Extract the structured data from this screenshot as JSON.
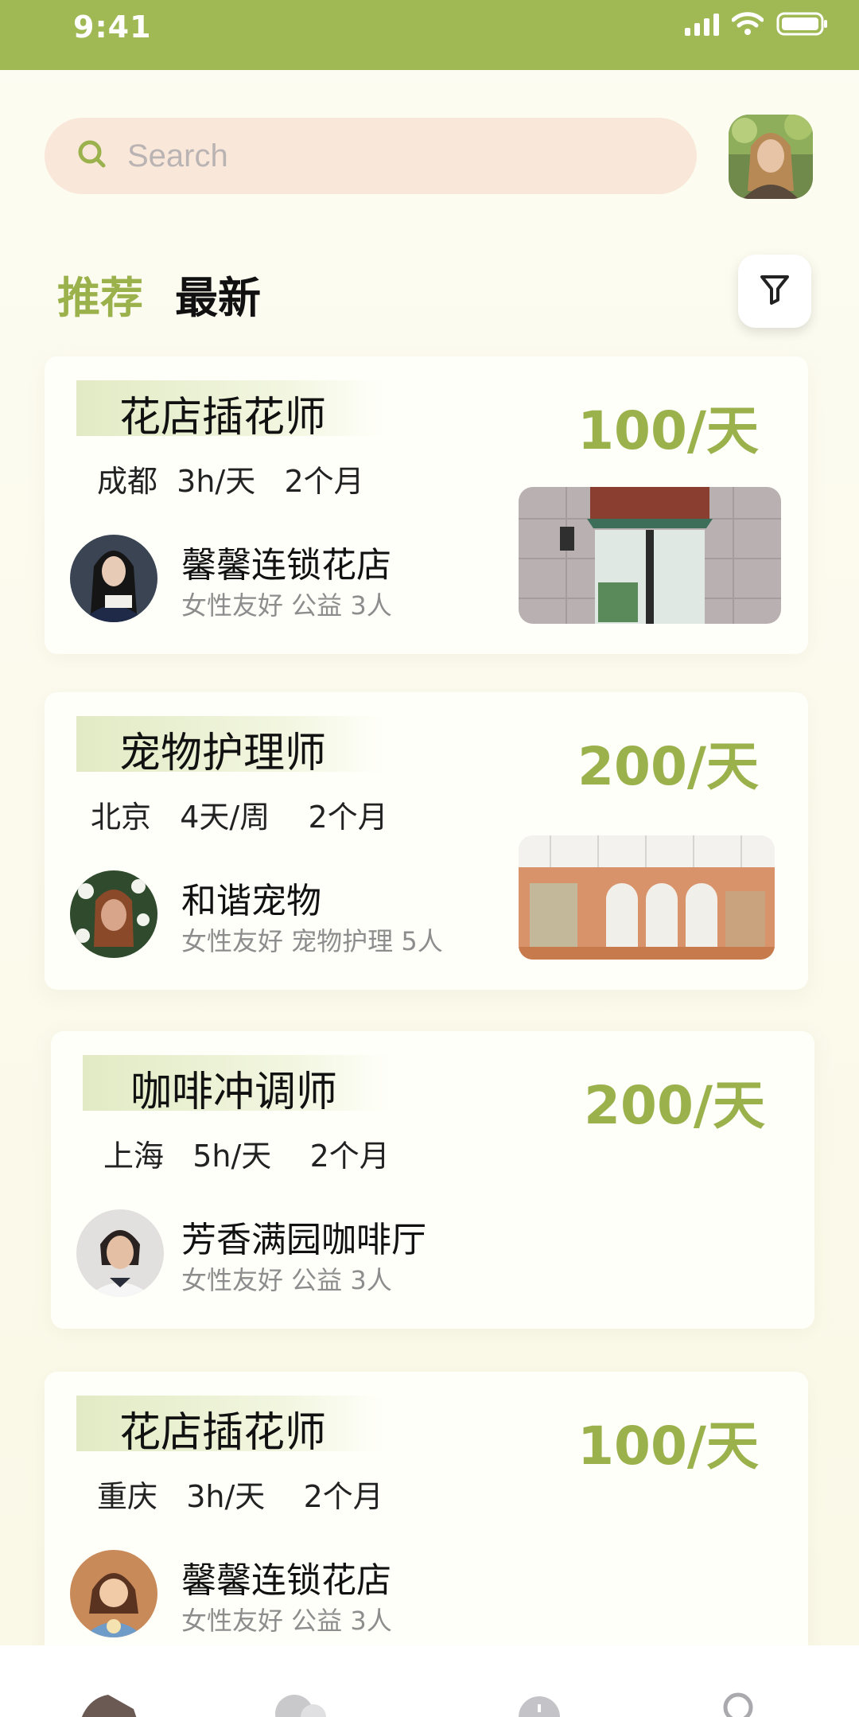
{
  "status_bar": {
    "time": "9:41"
  },
  "search": {
    "placeholder": "Search"
  },
  "tabs": [
    {
      "label": "推荐",
      "active": true
    },
    {
      "label": "最新",
      "active": false
    }
  ],
  "colors": {
    "accent": "#9ab14c",
    "status_bar": "#a0b955",
    "search_bg": "#f9e8d9"
  },
  "jobs": [
    {
      "title": "花店插花师",
      "meta": "成都  3h/天   2个月",
      "salary": "100/天",
      "company": "馨馨连锁花店",
      "tags": "女性友好 公益  3人",
      "has_photo": true
    },
    {
      "title": "宠物护理师",
      "meta": "北京   4天/周    2个月",
      "salary": "200/天",
      "company": "和谐宠物",
      "tags": "女性友好 宠物护理  5人",
      "has_photo": true
    },
    {
      "title": "咖啡冲调师",
      "meta": "上海   5h/天    2个月",
      "salary": "200/天",
      "company": "芳香满园咖啡厅",
      "tags": "女性友好 公益  3人",
      "has_photo": false
    },
    {
      "title": "花店插花师",
      "meta": "重庆   3h/天    2个月",
      "salary": "100/天",
      "company": "馨馨连锁花店",
      "tags": "女性友好 公益  3人",
      "has_photo": false
    }
  ],
  "icons": {
    "search": "search-icon",
    "filter": "filter-icon",
    "nav": [
      "home-icon",
      "chat-icon",
      "message-icon",
      "profile-icon"
    ]
  }
}
